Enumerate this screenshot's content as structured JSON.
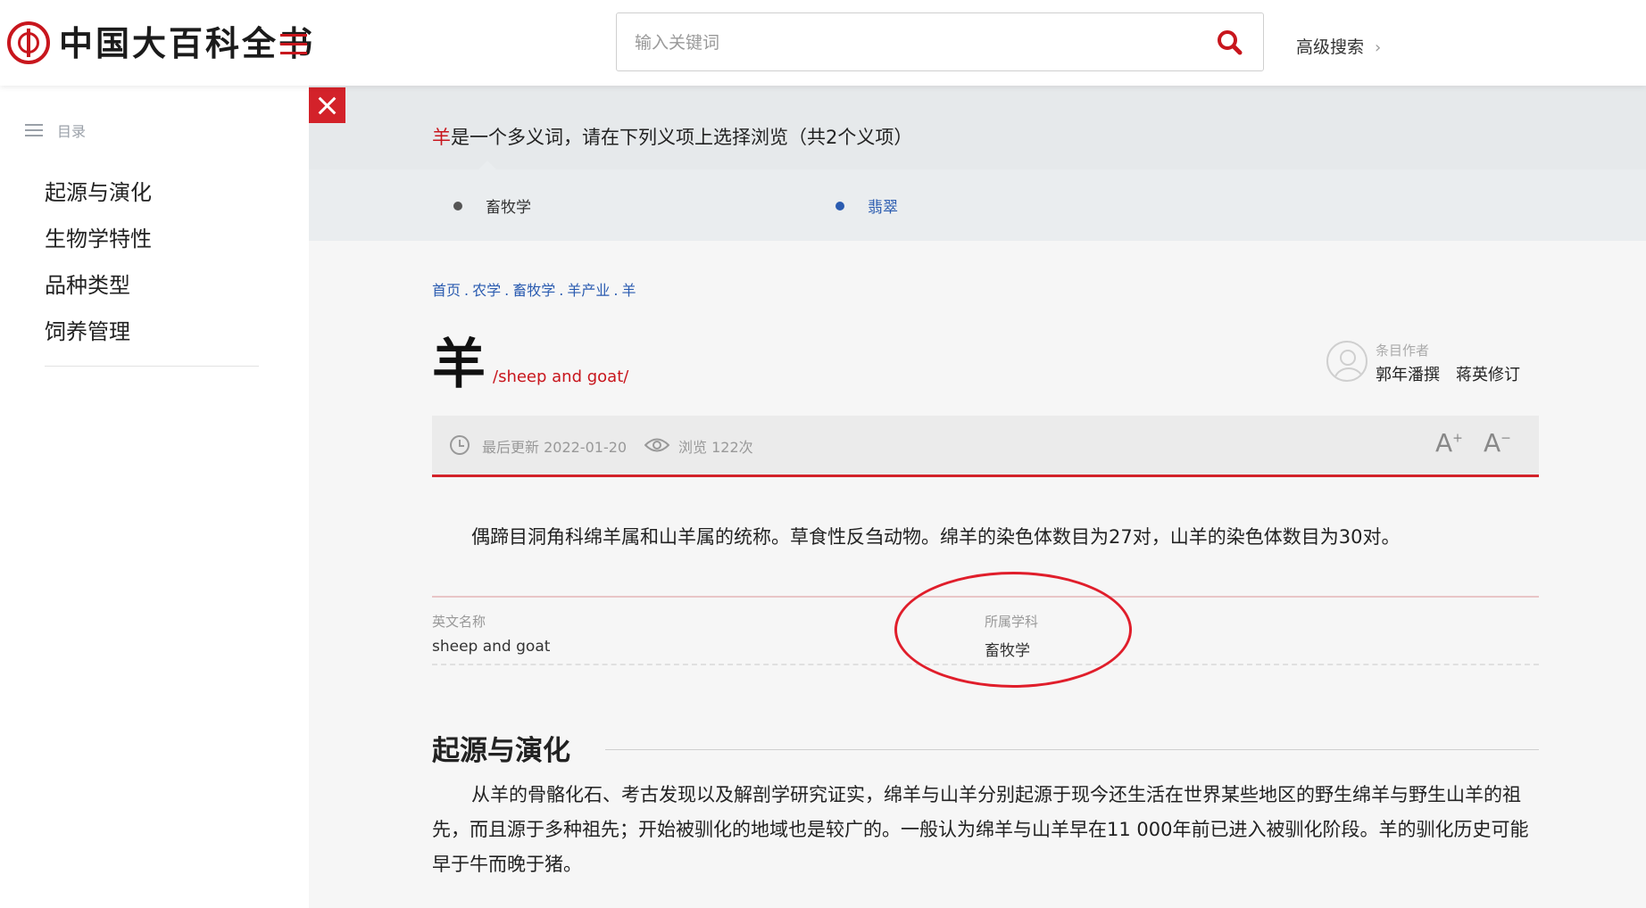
{
  "header": {
    "logo_text": "中国大百科全书",
    "search_placeholder": "输入关键词",
    "advanced_search": "高级搜索"
  },
  "sidebar": {
    "toc_label": "目录",
    "items": [
      "起源与演化",
      "生物学特性",
      "品种类型",
      "饲养管理"
    ]
  },
  "polysemy": {
    "term": "羊",
    "message": "是一个多义词，请在下列义项上选择浏览（共2个义项）",
    "senses": [
      "畜牧学",
      "翡翠"
    ]
  },
  "breadcrumb": [
    "首页",
    "农学",
    "畜牧学",
    "羊产业",
    "羊"
  ],
  "entry": {
    "title": "羊",
    "subtitle": "/sheep and goat/",
    "author_label": "条目作者",
    "authors": "郭年潘撰　蒋英修订",
    "last_updated": "最后更新 2022-01-20",
    "views": "浏览 122次",
    "font_up": "A",
    "font_down": "A",
    "summary": "偶蹄目洞角科绵羊属和山羊属的统称。草食性反刍动物。绵羊的染色体数目为27对，山羊的染色体数目为30对。"
  },
  "attributes": {
    "english_name_label": "英文名称",
    "english_name": "sheep and goat",
    "subject_label": "所属学科",
    "subject": "畜牧学"
  },
  "section": {
    "title": "起源与演化",
    "body": "从羊的骨骼化石、考古发现以及解剖学研究证实，绵羊与山羊分别起源于现今还生活在世界某些地区的野生绵羊与野生山羊的祖先，而且源于多种祖先；开始被驯化的地域也是较广的。一般认为绵羊与山羊早在11 000年前已进入被驯化阶段。羊的驯化历史可能早于牛而晚于猪。"
  },
  "colors": {
    "brand_red": "#c8161d",
    "link_blue": "#2a5bb0",
    "annotation_red": "#e01e2b"
  }
}
